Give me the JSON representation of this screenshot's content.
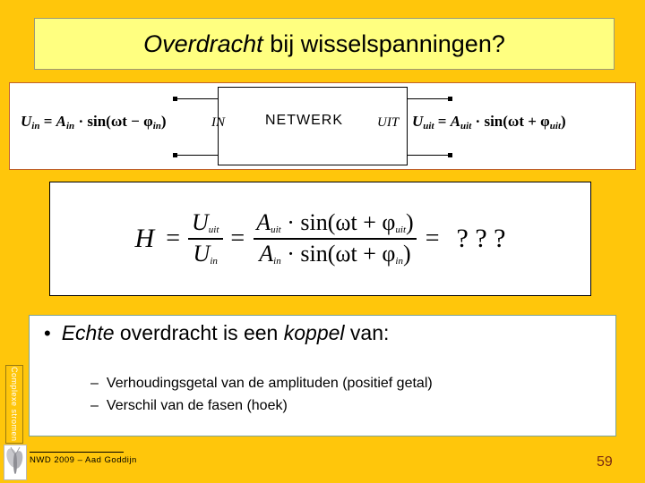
{
  "slide": {
    "title_italic": "Overdracht",
    "title_rest": " bij wisselspanningen?",
    "background_color": "#FFC60B",
    "title_box_color": "#FFFF80"
  },
  "diagram": {
    "formula_in": {
      "lhs": "U",
      "lhs_sub": "in",
      "eq": " = ",
      "amp": "A",
      "amp_sub": "in",
      "dot": " · ",
      "sin": "sin",
      "arg": "(ωt − φ",
      "arg_sub": "in",
      "arg_close": ")"
    },
    "label_in": "IN",
    "network_label": "NETWERK",
    "label_uit": "UIT",
    "formula_uit": {
      "lhs": "U",
      "lhs_sub": "uit",
      "eq": " = ",
      "amp": "A",
      "amp_sub": "uit",
      "dot": " · ",
      "sin": "sin",
      "arg": "(ωt + φ",
      "arg_sub": "uit",
      "arg_close": ")"
    }
  },
  "transfer_formula": {
    "h_symbol": "H",
    "equals_1": "=",
    "frac1_num": "U",
    "frac1_num_sub": "uit",
    "frac1_den": "U",
    "frac1_den_sub": "in",
    "equals_2": "=",
    "frac2_num_amp": "A",
    "frac2_num_amp_sub": "uit",
    "frac2_num_dot": " · ",
    "frac2_num_sin": "sin",
    "frac2_num_arg": "(ωt + φ",
    "frac2_num_arg_sub": "uit",
    "frac2_num_close": ")",
    "frac2_den_amp": "A",
    "frac2_den_amp_sub": "in",
    "frac2_den_dot": " · ",
    "frac2_den_sin": "sin",
    "frac2_den_arg": "(ωt + φ",
    "frac2_den_arg_sub": "in",
    "frac2_den_close": ")",
    "equals_3": "=",
    "result": "? ? ?"
  },
  "bullets": {
    "bullet_marker": "•",
    "main_italic_1": "Echte",
    "main_plain_1": " overdracht is een ",
    "main_italic_2": "koppel",
    "main_plain_2": " van:",
    "dash": "–",
    "sub_items": [
      "Verhoudingsgetal van de amplituden (positief getal)",
      "Verschil van de fasen  (hoek)"
    ]
  },
  "side_tab": {
    "label": "Complexe stromen"
  },
  "footer": {
    "credit": "NWD 2009 – Aad Goddijn",
    "page_number": "59",
    "page_number_color": "#7a2b12"
  }
}
